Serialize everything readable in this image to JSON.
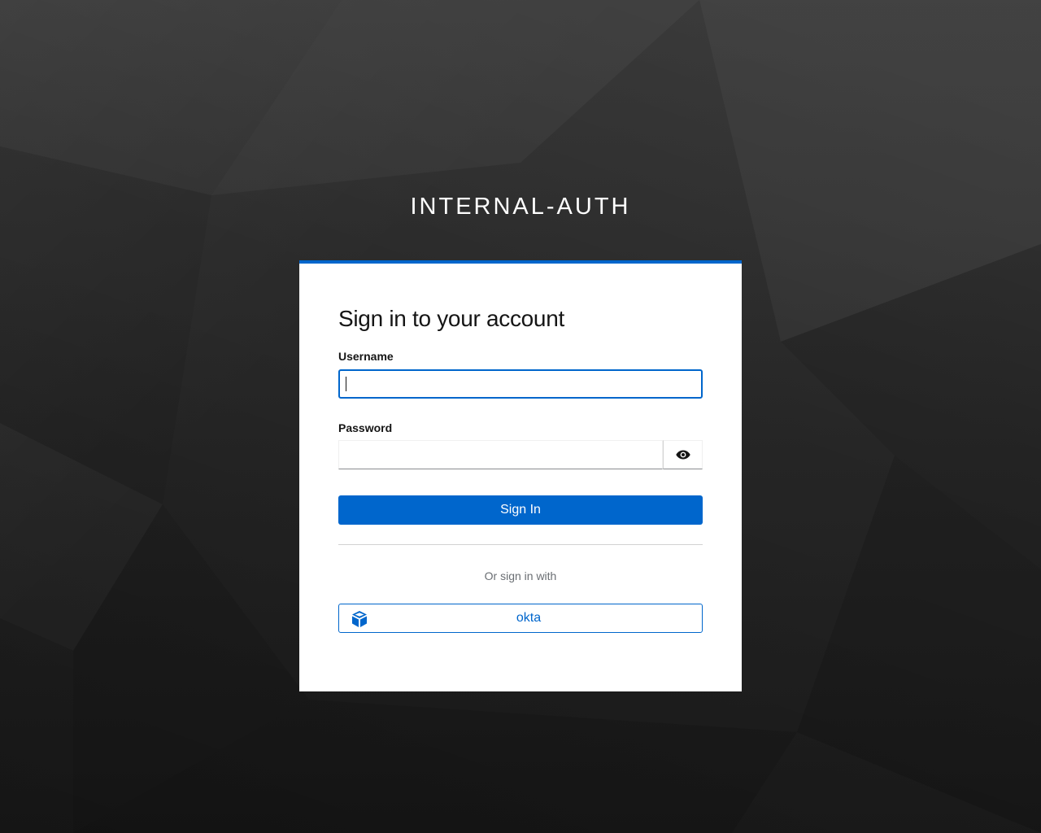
{
  "realm": {
    "title": "INTERNAL-AUTH"
  },
  "login_form": {
    "heading": "Sign in to your account",
    "username_label": "Username",
    "username_value": "",
    "password_label": "Password",
    "password_value": "",
    "show_password_icon": "eye-icon",
    "submit_label": "Sign In",
    "divider_text": "Or sign in with"
  },
  "identity_providers": [
    {
      "label": "okta",
      "icon": "cube-icon"
    }
  ],
  "colors": {
    "accent": "#0066cc",
    "background": "#262626",
    "card": "#ffffff",
    "text": "#151515",
    "muted_text": "#6a6e73"
  }
}
